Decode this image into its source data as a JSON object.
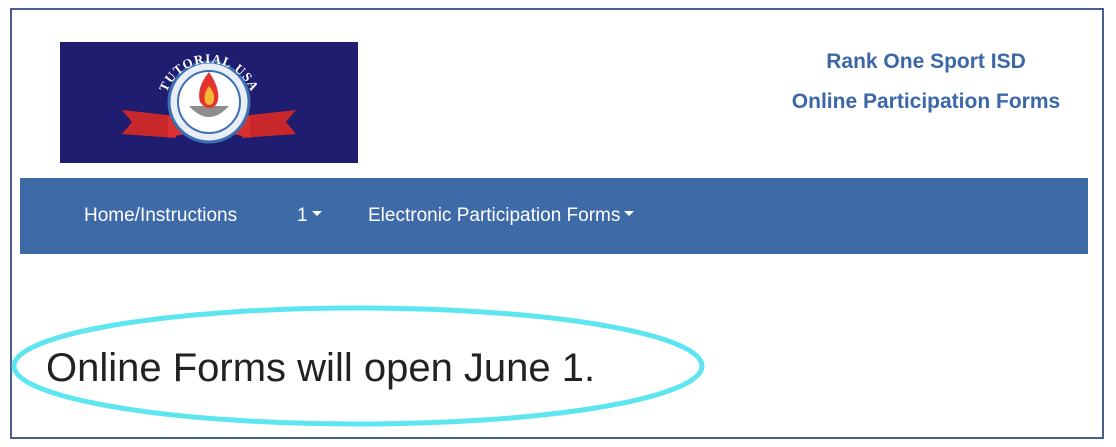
{
  "header": {
    "logo": {
      "text": "TUTORIAL USA",
      "icon": "torch-flame-emblem",
      "background": "#1f1d6f",
      "ribbon_color": "#c8282b"
    },
    "brand_line1": "Rank One Sport ISD",
    "brand_line2": "Online Participation Forms",
    "brand_color": "#3b67a8"
  },
  "navbar": {
    "background": "#3e6aa8",
    "items": [
      {
        "label": "Home/Instructions",
        "dropdown": false
      },
      {
        "label": "1",
        "dropdown": true
      },
      {
        "label": "Electronic Participation Forms",
        "dropdown": true
      }
    ]
  },
  "main": {
    "notice": "Online Forms will open June 1.",
    "highlight_color": "#5ee6f0"
  }
}
